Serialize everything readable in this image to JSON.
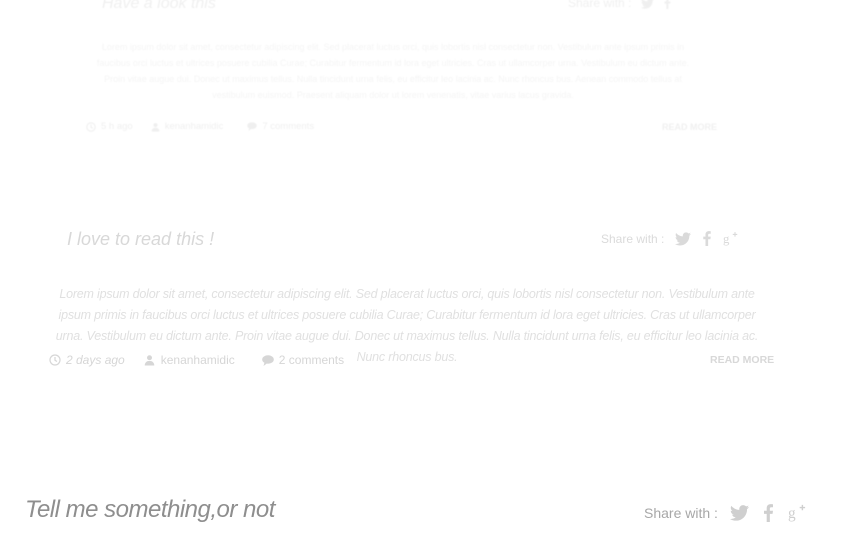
{
  "colors": {
    "text_faint": "#d4d4d4",
    "title_dark": "#8e8e8e",
    "icon": "#cfcfcf"
  },
  "posts": [
    {
      "title": "Have a look this",
      "share_label": "Share with :",
      "body": "Lorem ipsum dolor sit amet, consectetur adipiscing elit. Sed placerat luctus orci, quis lobortis nisl consectetur non. Vestibulum ante ipsum primis in faucibus orci luctus et ultrices posuere cubilia Curae; Curabitur fermentum id lora eget ultricies. Cras ut ullamcorper urna. Vestibulum eu dictum ante. Proin vitae augue dui. Donec ut maximus tellus. Nulla tincidunt urna felis, eu efficitur leo lacinia ac. Nunc rhoncus bus. Aenean commodo tellus at vestibulum euismod. Praesent aliquam dolor ut lorem venenatis, vitae varius lacus gravida.",
      "time": "5 h ago",
      "author": "kenanhamidic",
      "comments": "7 comments",
      "read_more": "READ MORE"
    },
    {
      "title": "I love to read this !",
      "share_label": "Share with :",
      "body": "Lorem ipsum dolor sit amet, consectetur adipiscing elit. Sed placerat luctus orci, quis lobortis nisl consectetur non. Vestibulum ante ipsum primis in faucibus orci luctus et ultrices posuere cubilia Curae; Curabitur fermentum id lora eget ultricies. Cras ut ullamcorper urna. Vestibulum eu dictum ante. Proin vitae augue dui. Donec ut maximus tellus. Nulla tincidunt urna felis, eu efficitur leo lacinia ac. Nunc rhoncus bus.",
      "time": "2 days ago",
      "author": "kenanhamidic",
      "comments": "2 comments",
      "read_more": "READ MORE"
    },
    {
      "title": "Tell me something,or not",
      "share_label": "Share with :"
    }
  ],
  "share_icons": [
    "twitter-icon",
    "facebook-icon",
    "google-plus-icon"
  ],
  "meta_icons": [
    "clock-icon",
    "user-icon",
    "comment-icon"
  ]
}
